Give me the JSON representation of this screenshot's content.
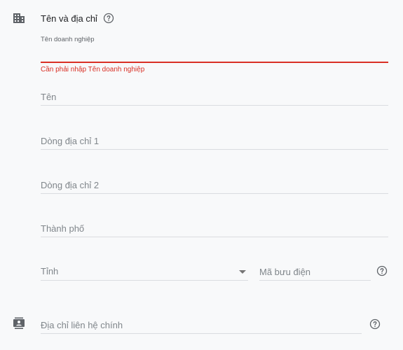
{
  "section": {
    "title": "Tên và địa chỉ",
    "icon": "business-building-icon"
  },
  "business_name": {
    "label": "Tên doanh nghiệp",
    "value": "",
    "error": "Cần phải nhập Tên doanh nghiệp"
  },
  "fields": {
    "name_placeholder": "Tên",
    "address1_placeholder": "Dòng địa chỉ 1",
    "address2_placeholder": "Dòng địa chỉ 2",
    "city_placeholder": "Thành phố",
    "province_label": "Tỉnh",
    "postal_placeholder": "Mã bưu điện",
    "contact_placeholder": "Địa chỉ liên hệ chính"
  },
  "colors": {
    "background": "#f8f9fa",
    "error": "#d93025",
    "text": "#202124",
    "hint": "#80868b",
    "icon": "#5f6368",
    "divider": "#dadce0"
  }
}
